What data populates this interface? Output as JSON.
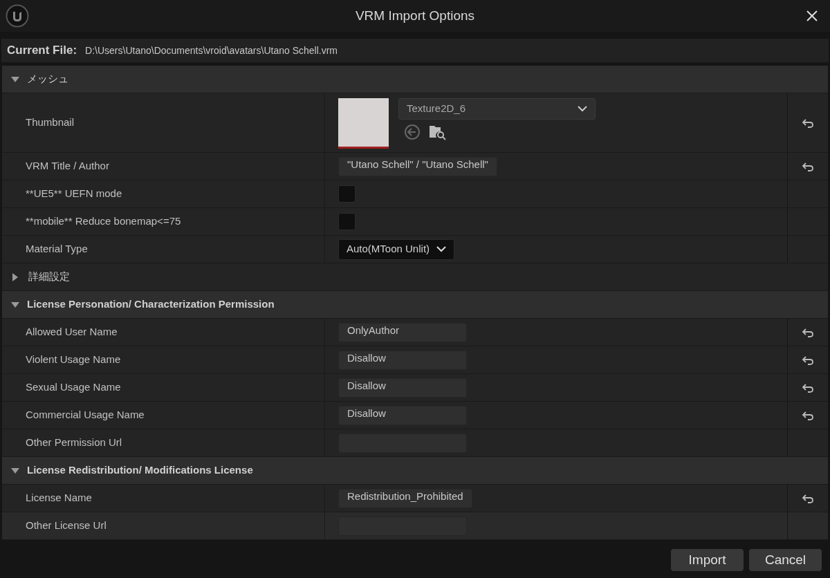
{
  "window": {
    "title": "VRM Import Options"
  },
  "current_file": {
    "label": "Current File:",
    "path": "D:\\Users\\Utano\\Documents\\vroid\\avatars\\Utano Schell.vrm"
  },
  "sections": [
    {
      "title": "メッシュ",
      "expanded": true,
      "rows": [
        {
          "kind": "asset",
          "label": "Thumbnail",
          "value": "Texture2D_6",
          "resettable": true
        },
        {
          "kind": "text",
          "label": "VRM Title / Author",
          "value": "\"Utano Schell\" / \"Utano Schell\"",
          "resettable": true
        },
        {
          "kind": "checkbox",
          "label": "**UE5** UEFN mode",
          "checked": false,
          "resettable": false
        },
        {
          "kind": "checkbox",
          "label": "**mobile** Reduce bonemap<=75",
          "checked": false,
          "resettable": false
        },
        {
          "kind": "combo",
          "label": "Material Type",
          "value": "Auto(MToon Unlit)",
          "resettable": false
        },
        {
          "kind": "group",
          "label": "詳細設定",
          "expanded": false
        }
      ]
    },
    {
      "title": "License Personation/ Characterization Permission",
      "expanded": true,
      "rows": [
        {
          "kind": "text",
          "label": "Allowed User Name",
          "value": "OnlyAuthor",
          "resettable": true
        },
        {
          "kind": "text",
          "label": "Violent Usage Name",
          "value": "Disallow",
          "resettable": true
        },
        {
          "kind": "text",
          "label": "Sexual Usage Name",
          "value": "Disallow",
          "resettable": true
        },
        {
          "kind": "text",
          "label": "Commercial Usage Name",
          "value": "Disallow",
          "resettable": true
        },
        {
          "kind": "text",
          "label": "Other Permission Url",
          "resettable": false
        }
      ]
    },
    {
      "title": "License Redistribution/ Modifications License",
      "expanded": true,
      "rows": [
        {
          "kind": "text",
          "label": "License Name",
          "value": "Redistribution_Prohibited",
          "resettable": true
        },
        {
          "kind": "text",
          "label": "Other License Url",
          "resettable": false
        }
      ]
    }
  ],
  "buttons": [
    "Import",
    "Cancel"
  ]
}
